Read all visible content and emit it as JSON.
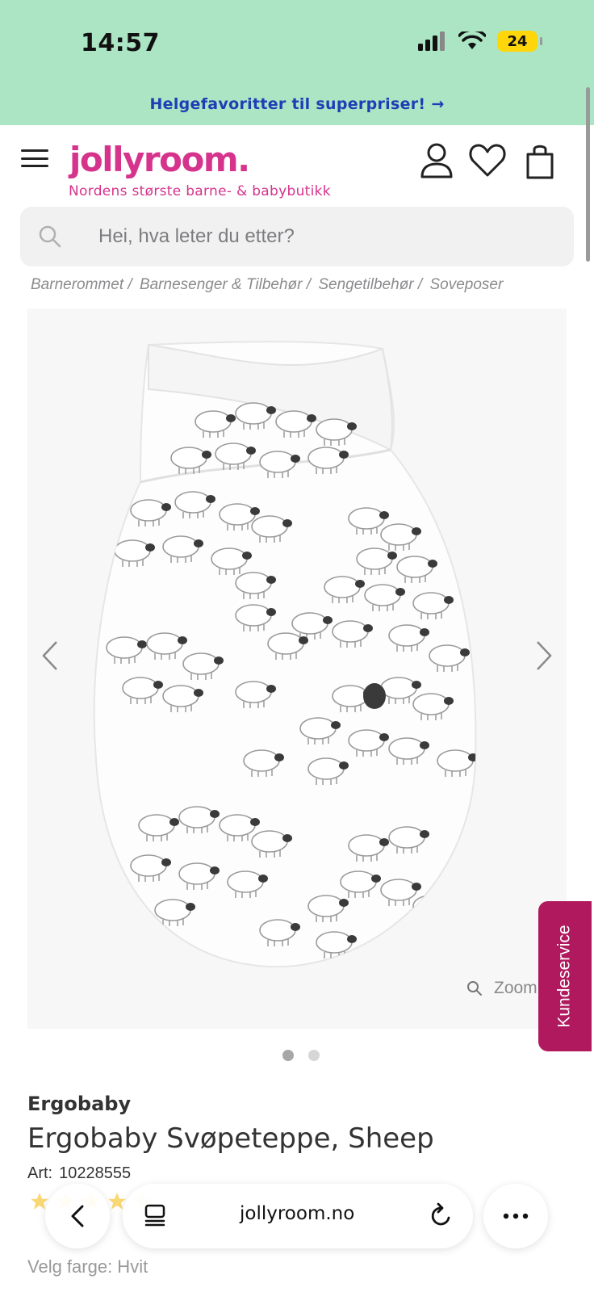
{
  "status_bar": {
    "time": "14:57",
    "battery": "24"
  },
  "promo": {
    "text": "Helgefavoritter til superpriser! →"
  },
  "header": {
    "logo": "jollyroom.",
    "tagline": "Nordens største barne- & babybutikk"
  },
  "search": {
    "placeholder": "Hei, hva leter du etter?"
  },
  "breadcrumb": [
    "Barnerommet /",
    "Barnesenger & Tilbehør /",
    "Sengetilbehør /",
    "Soveposer"
  ],
  "gallery": {
    "zoom_label": "Zoom",
    "slide_count": 2,
    "active_slide": 1
  },
  "customer_service": {
    "label": "Kundeservice"
  },
  "product": {
    "brand": "Ergobaby",
    "name": "Ergobaby Svøpeteppe, Sheep",
    "art_label": "Art:",
    "art_number": "10228555",
    "color_label": "Velg farge: Hvit"
  },
  "browser": {
    "url": "jollyroom.no"
  },
  "colors": {
    "mint": "#abe5c4",
    "brand_pink": "#d6338c",
    "promo_blue": "#1d3fb5",
    "service_magenta": "#b0195e"
  },
  "icons": [
    "menu-icon",
    "account-icon",
    "heart-icon",
    "cart-icon",
    "search-icon",
    "chevron-left-icon",
    "chevron-right-icon",
    "zoom-icon",
    "back-icon",
    "tabs-icon",
    "reload-icon",
    "more-icon"
  ]
}
